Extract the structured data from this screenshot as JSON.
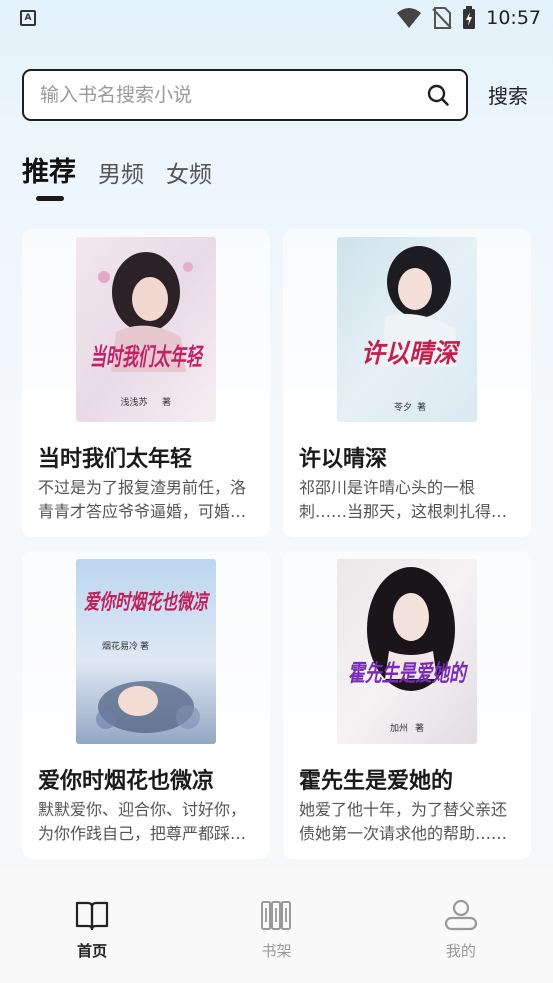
{
  "status_bar": {
    "app_icon": "A",
    "time": "10:57",
    "icons": [
      "wifi-icon",
      "no-sim-icon",
      "battery-charging-icon"
    ]
  },
  "search": {
    "placeholder": "输入书名搜索小说",
    "button_label": "搜索"
  },
  "tabs": [
    {
      "label": "推荐",
      "active": true
    },
    {
      "label": "男频",
      "active": false
    },
    {
      "label": "女频",
      "active": false
    }
  ],
  "books": [
    {
      "title": "当时我们太年轻",
      "description": "不过是为了报复渣男前任，洛青青才答应爷爷逼婚，可婚后……",
      "cover": {
        "title": "当时我们太年轻",
        "author": "浅浅苏",
        "author_suffix": "著",
        "accent": "#c0226a"
      }
    },
    {
      "title": "许以晴深",
      "description": "祁邵川是许晴心头的一根刺……当那天，这根刺扎得她鲜血淋漓",
      "cover": {
        "title": "许以晴深",
        "author": "苓夕",
        "author_suffix": "著",
        "accent": "#c4204e"
      }
    },
    {
      "title": "爱你时烟花也微凉",
      "description": "默默爱你、迎合你、讨好你，为你作践自己，把尊严都踩在脚下",
      "cover": {
        "title": "爱你时烟花也微凉",
        "author": "烟花易冷",
        "author_suffix": "著",
        "accent": "#c0205a"
      }
    },
    {
      "title": "霍先生是爱她的",
      "description": "她爱了他十年，为了替父亲还债她第一次请求他的帮助……",
      "cover": {
        "title": "霍先生是爱她的",
        "author": "加州",
        "author_suffix": "著",
        "accent": "#7a2bb5"
      }
    }
  ],
  "bottom_nav": [
    {
      "label": "首页",
      "icon": "book-open-icon",
      "active": true
    },
    {
      "label": "书架",
      "icon": "bookshelf-icon",
      "active": false
    },
    {
      "label": "我的",
      "icon": "user-icon",
      "active": false
    }
  ]
}
